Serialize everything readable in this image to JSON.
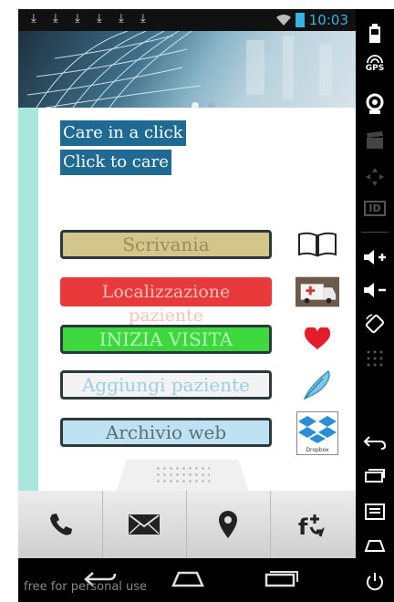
{
  "status_bar": {
    "time": "10:03",
    "notification_icons": [
      "download-icon",
      "download-icon",
      "download-icon",
      "download-icon",
      "download-icon",
      "download-icon"
    ]
  },
  "banner": {
    "page_indicator": {
      "active": 1,
      "count": 2
    }
  },
  "taglines": [
    "Care in a click",
    "Click to care"
  ],
  "menu": [
    {
      "label": "Scrivania",
      "bg": "#d4c68a",
      "text_color": "#9a8a5a",
      "icon": "book-icon"
    },
    {
      "label": "Localizzazione paziente",
      "bg": "#e83a3a",
      "text_color": "#f5c0c0",
      "icon": "ambulance-icon"
    },
    {
      "label": "INIZIA VISITA",
      "bg": "#3dd83d",
      "text_color": "#b9f6b9",
      "icon": "heart-icon"
    },
    {
      "label": "Aggiungi paziente",
      "bg": "#f3f3f3",
      "text_color": "#9ad0e3",
      "icon": "feather-icon"
    },
    {
      "label": "Archivio web",
      "bg": "#bfe2f3",
      "text_color": "#5a6e78",
      "icon": "dropbox-icon",
      "icon_caption": "Dropbox"
    }
  ],
  "bottom_bar": [
    "phone-icon",
    "mail-icon",
    "location-pin-icon",
    "facebook-add-icon"
  ],
  "watermark": "free for personal use",
  "side_rail": [
    "battery-icon",
    "gps-icon",
    "webcam-icon",
    "clapperboard-icon",
    "dpad-icon",
    "id-icon",
    "volume-up-icon",
    "volume-down-icon",
    "rotate-icon",
    "numpad-icon",
    "back-icon",
    "recents-icon",
    "menu-icon",
    "home-icon",
    "power-icon"
  ],
  "side_rail_text": {
    "gps": "GPS",
    "id": "ID"
  },
  "colors": {
    "accent": "#33b5e5",
    "tagline_bg": "#1e6a92",
    "side_strip": "#a9e7dc"
  }
}
